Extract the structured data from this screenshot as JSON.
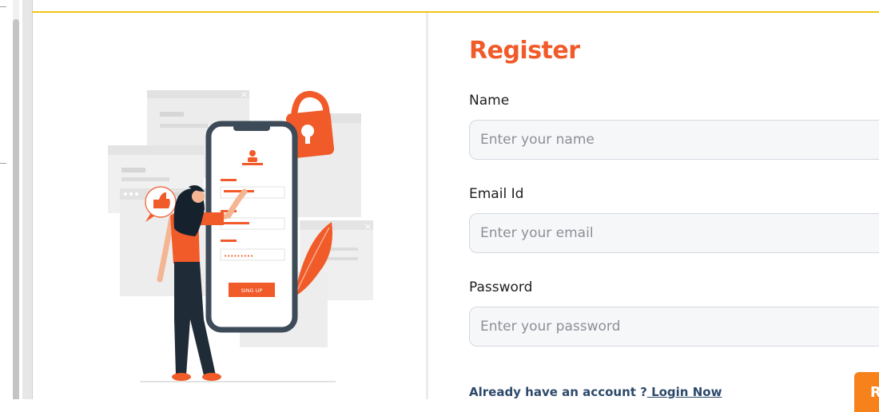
{
  "form": {
    "title": "Register",
    "name_label": "Name",
    "name_placeholder": "Enter your name",
    "email_label": "Email Id",
    "email_placeholder": "Enter your email",
    "password_label": "Password",
    "password_placeholder": "Enter your password",
    "login_prompt": "Already have an account ?",
    "login_link": " Login Now",
    "submit_label": "R"
  },
  "illustration": {
    "phone_button_label": "SING UP",
    "password_dots": "•••••••••"
  },
  "colors": {
    "accent": "#f15a29",
    "button": "#f7821b",
    "top_border": "#f0c419",
    "link": "#2d4a6b"
  }
}
